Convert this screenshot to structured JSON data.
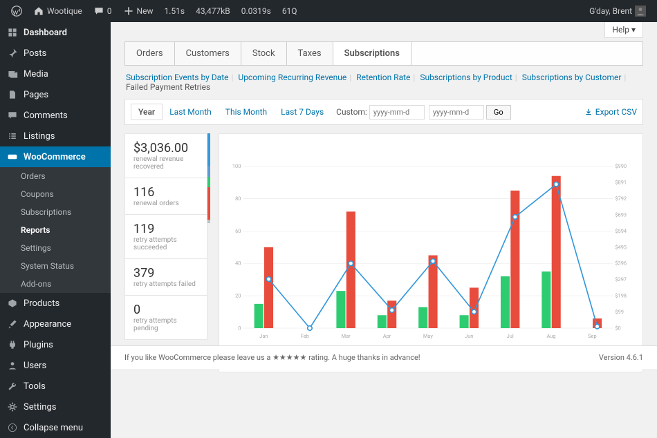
{
  "adminbar": {
    "site": "Wootique",
    "comments": "0",
    "new": "New",
    "stats": [
      "1.51s",
      "43,477kB",
      "0.0319s",
      "61Q"
    ],
    "user": "G'day, Brent"
  },
  "sidebar": {
    "dashboard": "Dashboard",
    "posts": "Posts",
    "media": "Media",
    "pages": "Pages",
    "comments": "Comments",
    "listings": "Listings",
    "woocommerce": "WooCommerce",
    "submenu": {
      "orders": "Orders",
      "coupons": "Coupons",
      "subscriptions": "Subscriptions",
      "reports": "Reports",
      "settings": "Settings",
      "system": "System Status",
      "addons": "Add-ons"
    },
    "products": "Products",
    "appearance": "Appearance",
    "plugins": "Plugins",
    "users": "Users",
    "tools": "Tools",
    "settings": "Settings",
    "collapse": "Collapse menu"
  },
  "help": "Help ▾",
  "tabs": {
    "orders": "Orders",
    "customers": "Customers",
    "stock": "Stock",
    "taxes": "Taxes",
    "subscriptions": "Subscriptions"
  },
  "subnav": {
    "events": "Subscription Events by Date",
    "recurring": "Upcoming Recurring Revenue",
    "retention": "Retention Rate",
    "byproduct": "Subscriptions by Product",
    "bycustomer": "Subscriptions by Customer",
    "failed": "Failed Payment Retries"
  },
  "ranges": {
    "year": "Year",
    "lastmonth": "Last Month",
    "thismonth": "This Month",
    "last7": "Last 7 Days",
    "custom": "Custom:",
    "ph": "yyyy-mm-d",
    "go": "Go",
    "export": "Export CSV"
  },
  "stats": [
    {
      "val": "$3,036.00",
      "lbl": "renewal revenue recovered"
    },
    {
      "val": "116",
      "lbl": "renewal orders"
    },
    {
      "val": "119",
      "lbl": "retry attempts succeeded"
    },
    {
      "val": "379",
      "lbl": "retry attempts failed"
    },
    {
      "val": "0",
      "lbl": "retry attempts pending"
    }
  ],
  "footer": {
    "text": "If you like WooCommerce please leave us a ★★★★★ rating. A huge thanks in advance!",
    "version": "Version 4.6.1"
  },
  "chart_data": {
    "type": "bar",
    "title": "",
    "categories": [
      "Jan",
      "Feb",
      "Mar",
      "Apr",
      "May",
      "Jun",
      "Jul",
      "Aug",
      "Sep"
    ],
    "series": [
      {
        "name": "retry attempts succeeded",
        "color": "#2ecc71",
        "values": [
          15,
          0,
          23,
          8,
          13,
          8,
          32,
          35,
          0
        ]
      },
      {
        "name": "retry attempts failed",
        "color": "#e74c3c",
        "values": [
          50,
          0,
          72,
          17,
          45,
          25,
          85,
          94,
          6
        ]
      },
      {
        "name": "renewal revenue recovered",
        "type": "line",
        "color": "#3498db",
        "y_axis": "right",
        "values": [
          300,
          0,
          396,
          110,
          410,
          100,
          680,
          880,
          10
        ]
      }
    ],
    "y_left": {
      "min": 0,
      "max": 100,
      "label": ""
    },
    "y_right": {
      "min": 0,
      "max": 990,
      "label": "",
      "prefix": "$"
    },
    "x_label": "",
    "y_label": ""
  }
}
